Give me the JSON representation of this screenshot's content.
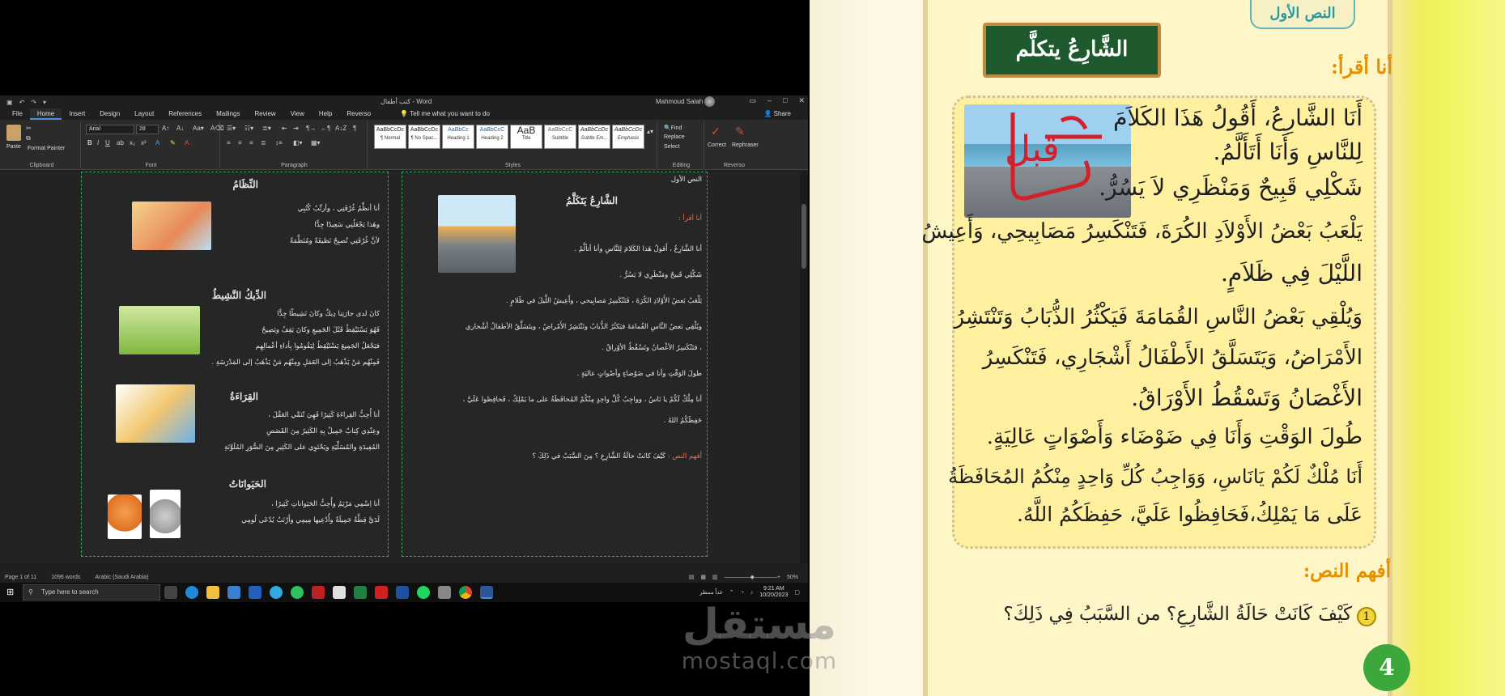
{
  "word": {
    "title": "كتب أطفال - Word",
    "user": "Mahmoud Salah",
    "menu": [
      "File",
      "Home",
      "Insert",
      "Design",
      "Layout",
      "References",
      "Mailings",
      "Review",
      "View",
      "Help",
      "Reverso"
    ],
    "tell_me": "Tell me what you want to do",
    "share": "Share",
    "ribbon": {
      "paste": "Paste",
      "format_painter": "Format Painter",
      "font_name": "Arial",
      "font_size": "28",
      "groups": [
        "Clipboard",
        "Font",
        "Paragraph",
        "Styles",
        "Editing",
        "Reverso"
      ],
      "styles": [
        {
          "preview": "AaBbCcDc",
          "name": "¶ Normal"
        },
        {
          "preview": "AaBbCcDc",
          "name": "¶ No Spac..."
        },
        {
          "preview": "AaBbCc",
          "name": "Heading 1"
        },
        {
          "preview": "AaBbCcC",
          "name": "Heading 2"
        },
        {
          "preview": "AaB",
          "name": "Title"
        },
        {
          "preview": "AaBbCcC",
          "name": "Subtitle"
        },
        {
          "preview": "AaBbCcDc",
          "name": "Subtle Em..."
        },
        {
          "preview": "AaBbCcDc",
          "name": "Emphasis"
        }
      ],
      "find": "Find",
      "replace": "Replace",
      "select": "Select",
      "correct": "Correct",
      "rephraser": "Rephraser"
    },
    "page_right": {
      "lesson": "النص الأول",
      "title": "الشَّارِعُ يَتَكَلَّمُ",
      "read_label": "أنا أقرأ :",
      "lines": [
        "أنا الشَّارِعُ ، أَقولُ هَذا الكَلامَ لِلنَّاسِ وأنا أتألَّمُ .",
        "شَكْلِي قَبيحٌ ومَنْظَرِي لا يَسُرُّ .",
        "يَلْعَبُ بَعضُ الأَوْلادِ الكُرَةَ ، فَتَنْكَسِرُ مَصابِيحي ، وأَعِيشُ اللَّيلَ في ظَلامٍ .",
        "ويُلْقِي بَعضُ النَّاسِ القُمامَةَ فيَكثُرُ الذُّبابُ وتَنْتَشِرُ الأَمْراضُ ، ويتَسَلَّقُ الأطفالُ أشْجاري",
        "، فتَنْكَسِرُ الأغْصانُ وتَسْقُطُ الأوْراقُ .",
        "طولَ الوَقْتِ وأنا في ضَوْضاءٍ وأصْواتٍ عاليَةٍ .",
        "أنا مِلْكٌ لَكُمْ يا نَاسُ ، وواجِبُ كُلِّ واحِدٍ مِنْكُمْ المُحافَظَةُ على ما يَمْلِكُ ، فَحافِظوا عَلَيَّ ،",
        "حَفِظَكُمُ اللهُ ."
      ],
      "question_label": "أفهم النص :",
      "question": "كَيْفَ كانَتْ حالَةُ الشَّارِعِ ؟ مِنَ السَّبَبُ في ذَلِكَ ؟"
    },
    "page_left": {
      "s1_title": "النِّظَامُ",
      "s1_lines": [
        "أنا أنظِّمُ غُرْفَتِي ، وأرتِّبُ كُتُبِي",
        "وهَذا يَجْعَلُنِي سَعِيدًا جِدًّا",
        "لأنَّ غُرْفَتِي تُصبِحُ نَظيفَةً ومُنَظَّمَةً"
      ],
      "s2_title": "الدِّيكُ النَّشِيطُ",
      "s2_lines": [
        "كانَ لدى جارَتِنا دِيكٌ وكانَ نَشِيطًا جِدًّا",
        "فَهُوَ يَسْتَيْقِظُ قَبْلَ الجَمِيعِ وكانَ يَقِفُ ويَصِيحُ",
        "فيَجْعَلُ الجَمِيعَ يَسْتَيْقِظُ لِيَقُومُوا بِأداءِ أعْمالِهِم",
        "فَمِنْهُم مَنْ يَذْهَبُ إلى العَمَلِ ومِنْهُم مَنْ يَذْهَبُ إلى المَدْرَسَةِ ."
      ],
      "s3_title": "القِرَاءَةُ",
      "s3_lines": [
        "أنا أُحِبُّ القِراءَةَ كَثِيرًا فَهِيَ تُنَمِّي العَقْلَ ،",
        "وعِنْدِي كِتابٌ جَمِيلٌ بِهِ الكَثِيرُ مِنَ القَصَصِ",
        "المُفِيدَةِ والمُسَلِّيَةِ ويَحْتَوِي على الكَثِيرِ مِنَ الصُّوَرِ المُلَوَّنَةِ"
      ],
      "s4_title": "الحَيَوانَاتُ",
      "s4_lines": [
        "أنا اِسْمِي مَرْيَمُ وأُحِبُّ الحَيَواناتِ كَثِيرًا ،",
        "لَدَيَّ قِطَّةٌ جَمِيلَةٌ وأُدْعِيها مِيمِي وأَرْنَبٌ يُدْعَى لُومِي"
      ]
    },
    "status": {
      "page": "Page 1 of 11",
      "words": "1096 words",
      "lang": "Arabic (Saudi Arabia)",
      "zoom": "50%"
    },
    "taskbar": {
      "search": "Type here to search",
      "weather": "غداً ممطر",
      "time": "9:21 AM",
      "date": "10/20/2023"
    }
  },
  "book": {
    "lesson_tag": "النص الأول",
    "board_title": "الشَّارِعُ يتكلَّم",
    "read_label": "أنا أقرأ:",
    "lines": [
      "أَنَا الشَّارِعُ، أَقُولُ هَذَا الكَلاَمَ",
      "لِلنَّاسِ وَأَنَا أَتَأَلَّمُ.",
      "شَكْلِي قَبِيحٌ وَمَنْظَرِي لاَ يَسُرُّ.",
      "يَلْعَبُ بَعْضُ الأَوْلاَدِ الكُرَةَ، فَتَنْكَسِرُ مَصَابِيحِي، وَأَعِيشُ",
      "اللَّيْلَ فِي ظَلاَمٍ.",
      "وَيُلْقِي بَعْضُ النَّاسِ القُمَامَةَ فَيَكْثُرُ الذُّبَابُ وَتَنْتَشِرُ",
      "الأَمْرَاضُ، وَيَتَسَلَّقُ الأَطْفَالُ أَشْجَارِي، فَتَنْكَسِرُ",
      "الأَغْصَانُ وَتَسْقُطُ الأَوْرَاقُ.",
      "طُولَ الوَقْتِ وَأَنَا فِي ضَوْضَاء وَأَصْوَاتٍ عَالِيَةٍ.",
      "أَنَا مُلْكٌ لَكُمْ يَانَاسِ، وَوَاجِبُ كُلِّ وَاحِدٍ مِنْكُمُ المُحَافَظَةُ",
      "عَلَى مَا يَمْلِكُ،فَحَافِظُوا عَلَيَّ، حَفِظَكُمُ اللَّهُ."
    ],
    "annotation": "قبل",
    "understand_label": "أفهم النص:",
    "q1_num": "1",
    "q1": "كَيْفَ كَانَتْ حَالَةُ الشَّارِعِ؟ من السَّبَبُ فِي ذَلِكَ؟",
    "page_number": "4"
  },
  "watermark": {
    "ar": "مستقل",
    "en": "mostaql.com"
  }
}
